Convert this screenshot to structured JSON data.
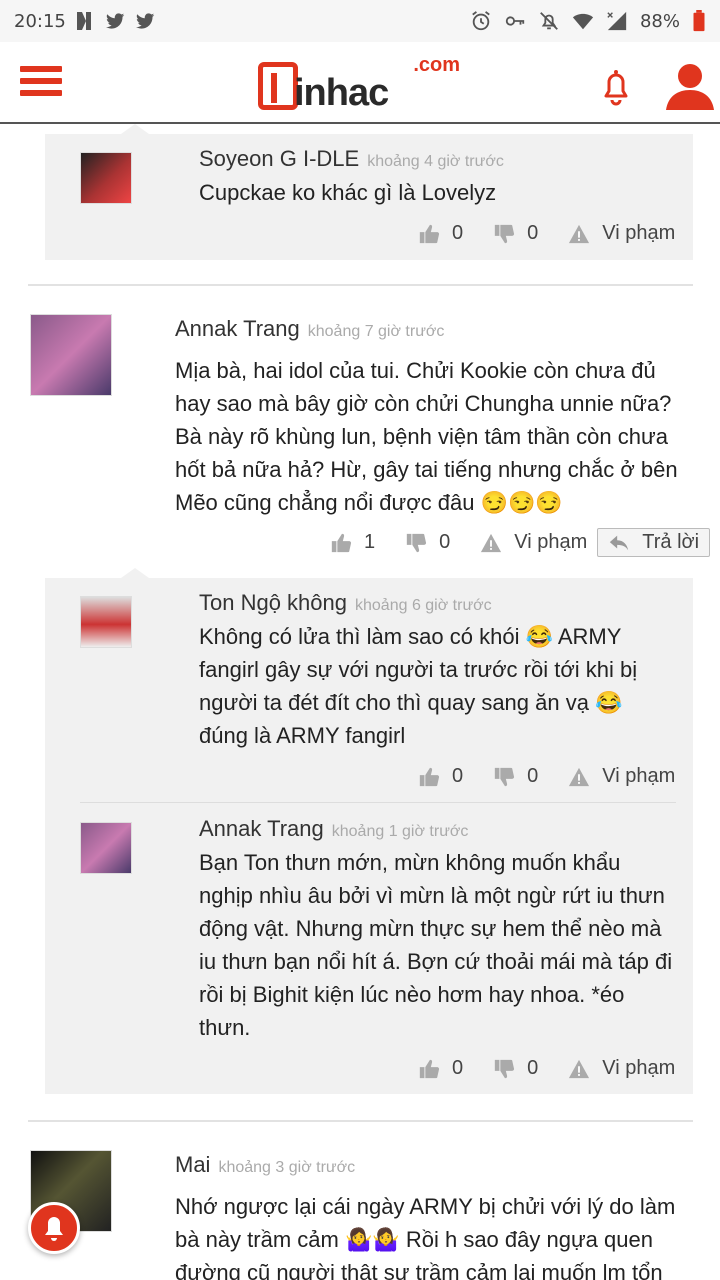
{
  "status_bar": {
    "time": "20:15",
    "battery": "88%"
  },
  "header": {
    "logo_dotcom": ".com",
    "logo_word": "inhac"
  },
  "comments": [
    {
      "id": "c1",
      "user": "Soyeon G I-DLE",
      "time": "khoảng 4 giờ trước",
      "text": "Cupckae ko khác gì là Lovelyz",
      "likes": "0",
      "dislikes": "0",
      "report": "Vi phạm"
    },
    {
      "id": "c2",
      "user": "Annak Trang",
      "time": "khoảng 7 giờ trước",
      "text": "Mịa bà, hai idol của tui. Chửi Kookie còn chưa đủ hay sao mà bây giờ còn chửi Chungha unnie nữa? Bà này rõ khùng lun, bệnh viện tâm thần còn chưa hốt bả nữa hả? Hừ, gây tai tiếng nhưng chắc ở bên Mẽo cũng chẳng nổi được đâu 😏😏😏",
      "likes": "1",
      "dislikes": "0",
      "report": "Vi phạm",
      "reply": "Trả lời"
    },
    {
      "id": "c3",
      "user": "Ton Ngộ không",
      "time": "khoảng 6 giờ trước",
      "text": "Không có lửa thì làm sao có khói 😂 ARMY fangirl gây sự với người ta trước rồi tới khi bị người ta đét đít cho thì quay sang ăn vạ 😂 đúng là ARMY fangirl",
      "likes": "0",
      "dislikes": "0",
      "report": "Vi phạm"
    },
    {
      "id": "c4",
      "user": "Annak Trang",
      "time": "khoảng 1 giờ trước",
      "text": "Bạn Ton thưn mớn, mừn không muốn khẩu nghịp nhìu âu bởi vì mừn là một ngừ rứt iu thưn động vật. Nhưng mừn thực sự hem thể nèo mà iu thưn bạn nổi hít á. Bợn cứ thoải mái mà táp đi rồi bị Bighit kiện lúc nèo hơm hay nhoa. *éo thưn.",
      "likes": "0",
      "dislikes": "0",
      "report": "Vi phạm"
    },
    {
      "id": "c5",
      "user": "Mai",
      "time": "khoảng 3 giờ trước",
      "text": "Nhớ ngược lại cái ngày ARMY bị chửi với lý do làm bà này trầm cảm 🤷‍♀️🤷‍♀️ Rồi h sao đây ngựa quen đường cũ người thật sự trầm cảm lại muốn lm tổn"
    }
  ],
  "colors": {
    "brand": "#e0351e",
    "reply_bg": "#f1f1f1"
  }
}
